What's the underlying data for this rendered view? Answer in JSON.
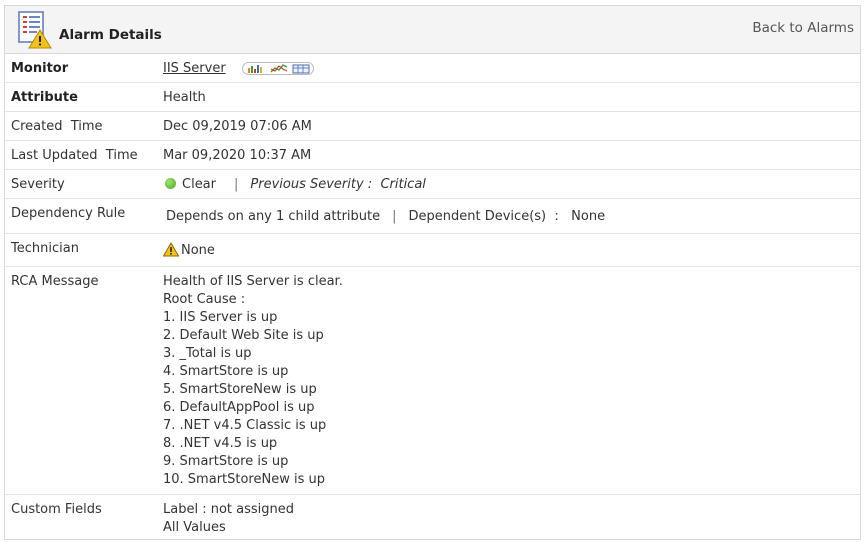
{
  "header": {
    "title": "Alarm Details",
    "back_link": "Back to Alarms"
  },
  "monitor": {
    "label": "Monitor",
    "value": "IIS Server"
  },
  "attribute": {
    "label": "Attribute",
    "value": "Health"
  },
  "created_time": {
    "label": "Created  Time",
    "value": "Dec 09,2019 07:06 AM"
  },
  "last_updated_time": {
    "label": "Last Updated  Time",
    "value": "Mar 09,2020 10:37 AM"
  },
  "severity": {
    "label": "Severity",
    "value": "Clear",
    "separator": "|",
    "previous": "Previous Severity :  Critical",
    "status_color": "#5cb82e"
  },
  "dependency_rule": {
    "label": "Dependency Rule",
    "value": "Depends on any 1 child attribute",
    "separator": "|",
    "devices": "Dependent Device(s)  :   None"
  },
  "technician": {
    "label": "Technician",
    "value": "None"
  },
  "rca_message": {
    "label": "RCA Message",
    "lines": [
      "Health of IIS Server is clear.",
      "Root Cause :",
      "1. IIS Server is up",
      "2. Default Web Site is up",
      "3. _Total is up",
      "4. SmartStore is up",
      "5. SmartStoreNew is up",
      "6. DefaultAppPool is up",
      "7. .NET v4.5 Classic is up",
      "8. .NET v4.5 is up",
      "9. SmartStore is up",
      "10. SmartStoreNew is up"
    ]
  },
  "custom_fields": {
    "label": "Custom Fields",
    "line1": "Label : not assigned",
    "line2": "All Values"
  }
}
